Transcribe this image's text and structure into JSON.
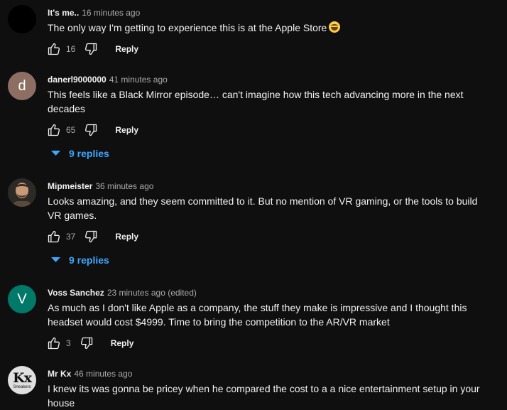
{
  "colors": {
    "background": "#0f0f0f",
    "link": "#3ea6ff",
    "muted": "#aaaaaa"
  },
  "comments": [
    {
      "author": "It's me..",
      "time": "16 minutes ago",
      "text": "The only way I'm getting to experience this is at the Apple Store",
      "emoji": "grinning-squinting-face",
      "likes": "16",
      "reply_label": "Reply",
      "avatar_color": "#000000"
    },
    {
      "author": "danerl9000000",
      "time": "41 minutes ago",
      "text": "This feels like a Black Mirror episode… can't imagine how this tech advancing more in the next decades",
      "likes": "65",
      "reply_label": "Reply",
      "replies_label": "9 replies",
      "avatar_letter": "d",
      "avatar_color": "#8d6e63"
    },
    {
      "author": "Mipmeister",
      "time": "36 minutes ago",
      "text": "Looks amazing, and they seem committed to it. But no mention of VR gaming, or the tools to build VR games.",
      "likes": "37",
      "reply_label": "Reply",
      "replies_label": "9 replies",
      "avatar_color": "#3a3128"
    },
    {
      "author": "Voss Sanchez",
      "time": "23 minutes ago (edited)",
      "text": "As much as I don't like Apple as a company, the stuff they make is impressive and I thought this headset would cost $4999. Time to bring the competition to the AR/VR market",
      "likes": "3",
      "reply_label": "Reply",
      "avatar_letter": "V",
      "avatar_color": "#00796b"
    },
    {
      "author": "Mr Kx",
      "time": "46 minutes ago",
      "text": "I knew its was gonna be pricey when he compared the cost to a a nice entertainment setup in your house",
      "avatar_letter": "Kx",
      "avatar_subtext": "Sneakers",
      "avatar_color": "#e0e0e0"
    }
  ]
}
